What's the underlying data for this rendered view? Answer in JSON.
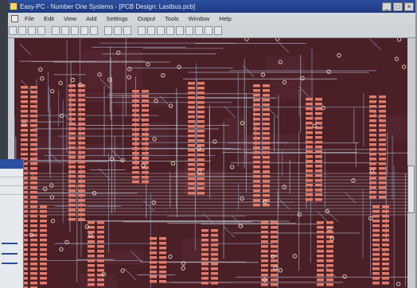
{
  "window": {
    "title": "Easy-PC - Number One Systems - [PCB Design: Lastbus.pcb]"
  },
  "menu": {
    "items": [
      "File",
      "Edit",
      "View",
      "Add",
      "Settings",
      "Output",
      "Tools",
      "Window",
      "Help"
    ]
  },
  "toolbar": {
    "buttons": [
      "new",
      "open",
      "save",
      "print",
      "cut",
      "copy",
      "paste",
      "undo",
      "redo",
      "zoom-in",
      "zoom-out",
      "zoom-fit",
      "route",
      "via",
      "pad",
      "track",
      "text",
      "measure",
      "grid",
      "layers",
      "drc"
    ]
  },
  "colors": {
    "board_bg": "#4a1f26",
    "track_primary": "#b4b8c4",
    "track_secondary": "#8f98b8",
    "pad_color": "#e07b6a",
    "title_bar": "#1d3a80"
  }
}
